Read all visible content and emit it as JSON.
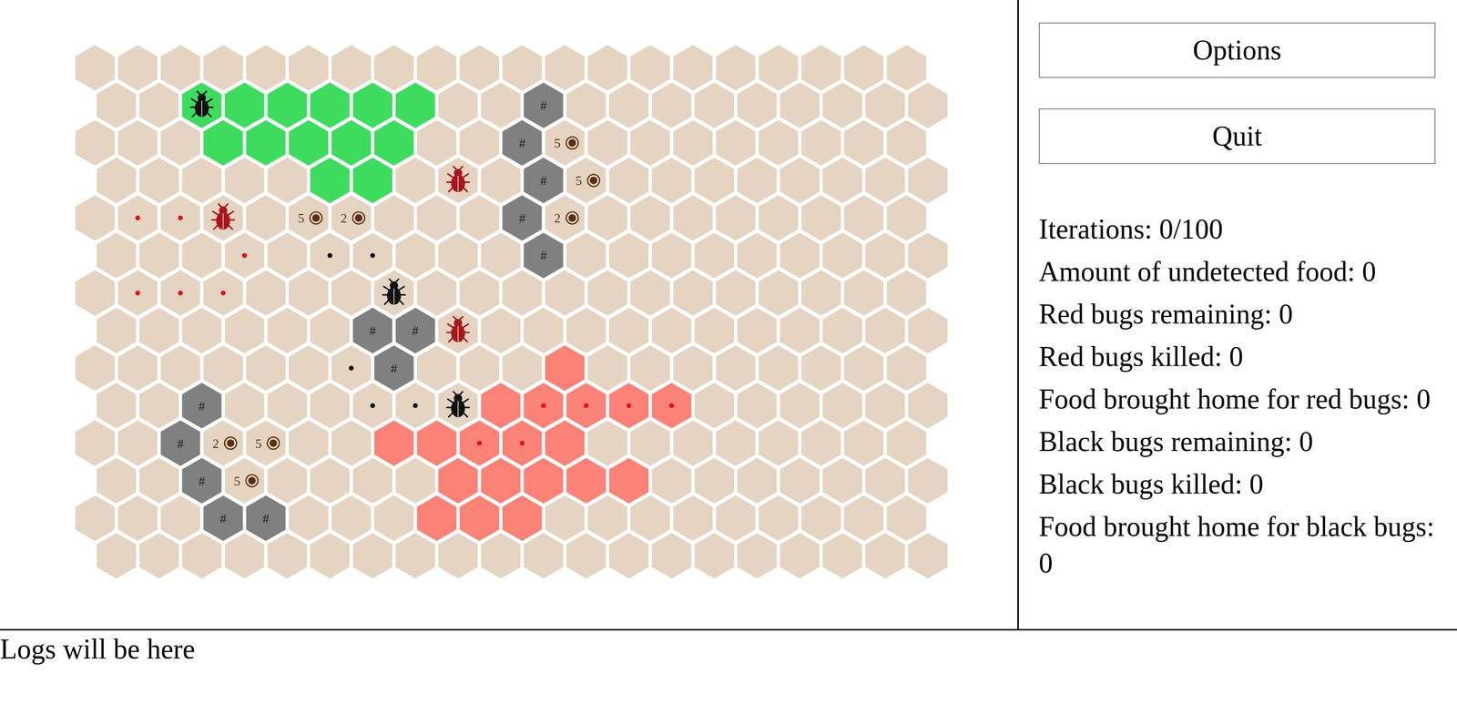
{
  "board": {
    "rows": 14,
    "cols": 20,
    "cells": [
      {
        "row": 1,
        "col": 2,
        "kind": "black-nest",
        "bug": "black"
      },
      {
        "row": 1,
        "col": 3,
        "kind": "black-nest"
      },
      {
        "row": 1,
        "col": 4,
        "kind": "black-nest"
      },
      {
        "row": 1,
        "col": 5,
        "kind": "black-nest"
      },
      {
        "row": 1,
        "col": 6,
        "kind": "black-nest"
      },
      {
        "row": 1,
        "col": 7,
        "kind": "black-nest"
      },
      {
        "row": 1,
        "col": 10,
        "kind": "rock",
        "label": "#"
      },
      {
        "row": 2,
        "col": 3,
        "kind": "black-nest"
      },
      {
        "row": 2,
        "col": 4,
        "kind": "black-nest"
      },
      {
        "row": 2,
        "col": 5,
        "kind": "black-nest"
      },
      {
        "row": 2,
        "col": 6,
        "kind": "black-nest"
      },
      {
        "row": 2,
        "col": 7,
        "kind": "black-nest"
      },
      {
        "row": 2,
        "col": 10,
        "kind": "rock",
        "label": "#"
      },
      {
        "row": 2,
        "col": 11,
        "kind": "food",
        "amount": "5"
      },
      {
        "row": 3,
        "col": 5,
        "kind": "black-nest"
      },
      {
        "row": 3,
        "col": 6,
        "kind": "black-nest"
      },
      {
        "row": 3,
        "col": 8,
        "kind": "ground",
        "bug": "red"
      },
      {
        "row": 3,
        "col": 10,
        "kind": "rock",
        "label": "#"
      },
      {
        "row": 3,
        "col": 11,
        "kind": "food",
        "amount": "5"
      },
      {
        "row": 4,
        "col": 1,
        "kind": "ground",
        "marker": "red"
      },
      {
        "row": 4,
        "col": 2,
        "kind": "ground",
        "marker": "red"
      },
      {
        "row": 4,
        "col": 3,
        "kind": "ground",
        "bug": "red"
      },
      {
        "row": 4,
        "col": 5,
        "kind": "food",
        "amount": "5"
      },
      {
        "row": 4,
        "col": 6,
        "kind": "food",
        "amount": "2"
      },
      {
        "row": 4,
        "col": 10,
        "kind": "rock",
        "label": "#"
      },
      {
        "row": 4,
        "col": 11,
        "kind": "food",
        "amount": "2"
      },
      {
        "row": 5,
        "col": 3,
        "kind": "ground",
        "marker": "red"
      },
      {
        "row": 5,
        "col": 5,
        "kind": "ground",
        "marker": "black"
      },
      {
        "row": 5,
        "col": 6,
        "kind": "ground",
        "marker": "black"
      },
      {
        "row": 5,
        "col": 10,
        "kind": "rock",
        "label": "#"
      },
      {
        "row": 6,
        "col": 1,
        "kind": "ground",
        "marker": "red"
      },
      {
        "row": 6,
        "col": 2,
        "kind": "ground",
        "marker": "red"
      },
      {
        "row": 6,
        "col": 3,
        "kind": "ground",
        "marker": "red"
      },
      {
        "row": 6,
        "col": 7,
        "kind": "ground",
        "bug": "black"
      },
      {
        "row": 7,
        "col": 6,
        "kind": "rock",
        "label": "#"
      },
      {
        "row": 7,
        "col": 7,
        "kind": "rock",
        "label": "#"
      },
      {
        "row": 7,
        "col": 8,
        "kind": "ground",
        "bug": "red"
      },
      {
        "row": 8,
        "col": 6,
        "kind": "ground",
        "marker": "black"
      },
      {
        "row": 8,
        "col": 7,
        "kind": "rock",
        "label": "#"
      },
      {
        "row": 8,
        "col": 11,
        "kind": "red-nest"
      },
      {
        "row": 9,
        "col": 2,
        "kind": "rock",
        "label": "#"
      },
      {
        "row": 9,
        "col": 6,
        "kind": "ground",
        "marker": "black"
      },
      {
        "row": 9,
        "col": 7,
        "kind": "ground",
        "marker": "black"
      },
      {
        "row": 9,
        "col": 8,
        "kind": "ground",
        "bug": "black"
      },
      {
        "row": 9,
        "col": 9,
        "kind": "red-nest"
      },
      {
        "row": 9,
        "col": 10,
        "kind": "red-nest",
        "marker": "red"
      },
      {
        "row": 9,
        "col": 11,
        "kind": "red-nest",
        "marker": "red"
      },
      {
        "row": 9,
        "col": 12,
        "kind": "red-nest",
        "marker": "red"
      },
      {
        "row": 9,
        "col": 13,
        "kind": "red-nest",
        "marker": "red"
      },
      {
        "row": 10,
        "col": 2,
        "kind": "rock",
        "label": "#"
      },
      {
        "row": 10,
        "col": 3,
        "kind": "food",
        "amount": "2"
      },
      {
        "row": 10,
        "col": 4,
        "kind": "food",
        "amount": "5"
      },
      {
        "row": 10,
        "col": 7,
        "kind": "red-nest"
      },
      {
        "row": 10,
        "col": 8,
        "kind": "red-nest"
      },
      {
        "row": 10,
        "col": 9,
        "kind": "red-nest",
        "marker": "red"
      },
      {
        "row": 10,
        "col": 10,
        "kind": "red-nest",
        "marker": "red"
      },
      {
        "row": 10,
        "col": 11,
        "kind": "red-nest"
      },
      {
        "row": 11,
        "col": 2,
        "kind": "rock",
        "label": "#"
      },
      {
        "row": 11,
        "col": 3,
        "kind": "food",
        "amount": "5"
      },
      {
        "row": 11,
        "col": 8,
        "kind": "red-nest"
      },
      {
        "row": 11,
        "col": 9,
        "kind": "red-nest"
      },
      {
        "row": 11,
        "col": 10,
        "kind": "red-nest"
      },
      {
        "row": 11,
        "col": 11,
        "kind": "red-nest"
      },
      {
        "row": 11,
        "col": 12,
        "kind": "red-nest"
      },
      {
        "row": 12,
        "col": 3,
        "kind": "rock",
        "label": "#"
      },
      {
        "row": 12,
        "col": 4,
        "kind": "rock",
        "label": "#"
      },
      {
        "row": 12,
        "col": 8,
        "kind": "red-nest"
      },
      {
        "row": 12,
        "col": 9,
        "kind": "red-nest"
      },
      {
        "row": 12,
        "col": 10,
        "kind": "red-nest"
      }
    ]
  },
  "buttons": [
    {
      "label": "Options"
    },
    {
      "label": "Quit"
    }
  ],
  "stats": [
    {
      "label": "Iterations: 0/100"
    },
    {
      "label": "Amount of undetected food: 0"
    },
    {
      "label": "Red bugs remaining: 0"
    },
    {
      "label": "Red bugs killed: 0"
    },
    {
      "label": "Food brought home for red bugs: 0"
    },
    {
      "label": "Black bugs remaining: 0"
    },
    {
      "label": "Black bugs killed: 0"
    },
    {
      "label": "Food brought home for black bugs: 0"
    }
  ],
  "logs": "Logs will be here"
}
